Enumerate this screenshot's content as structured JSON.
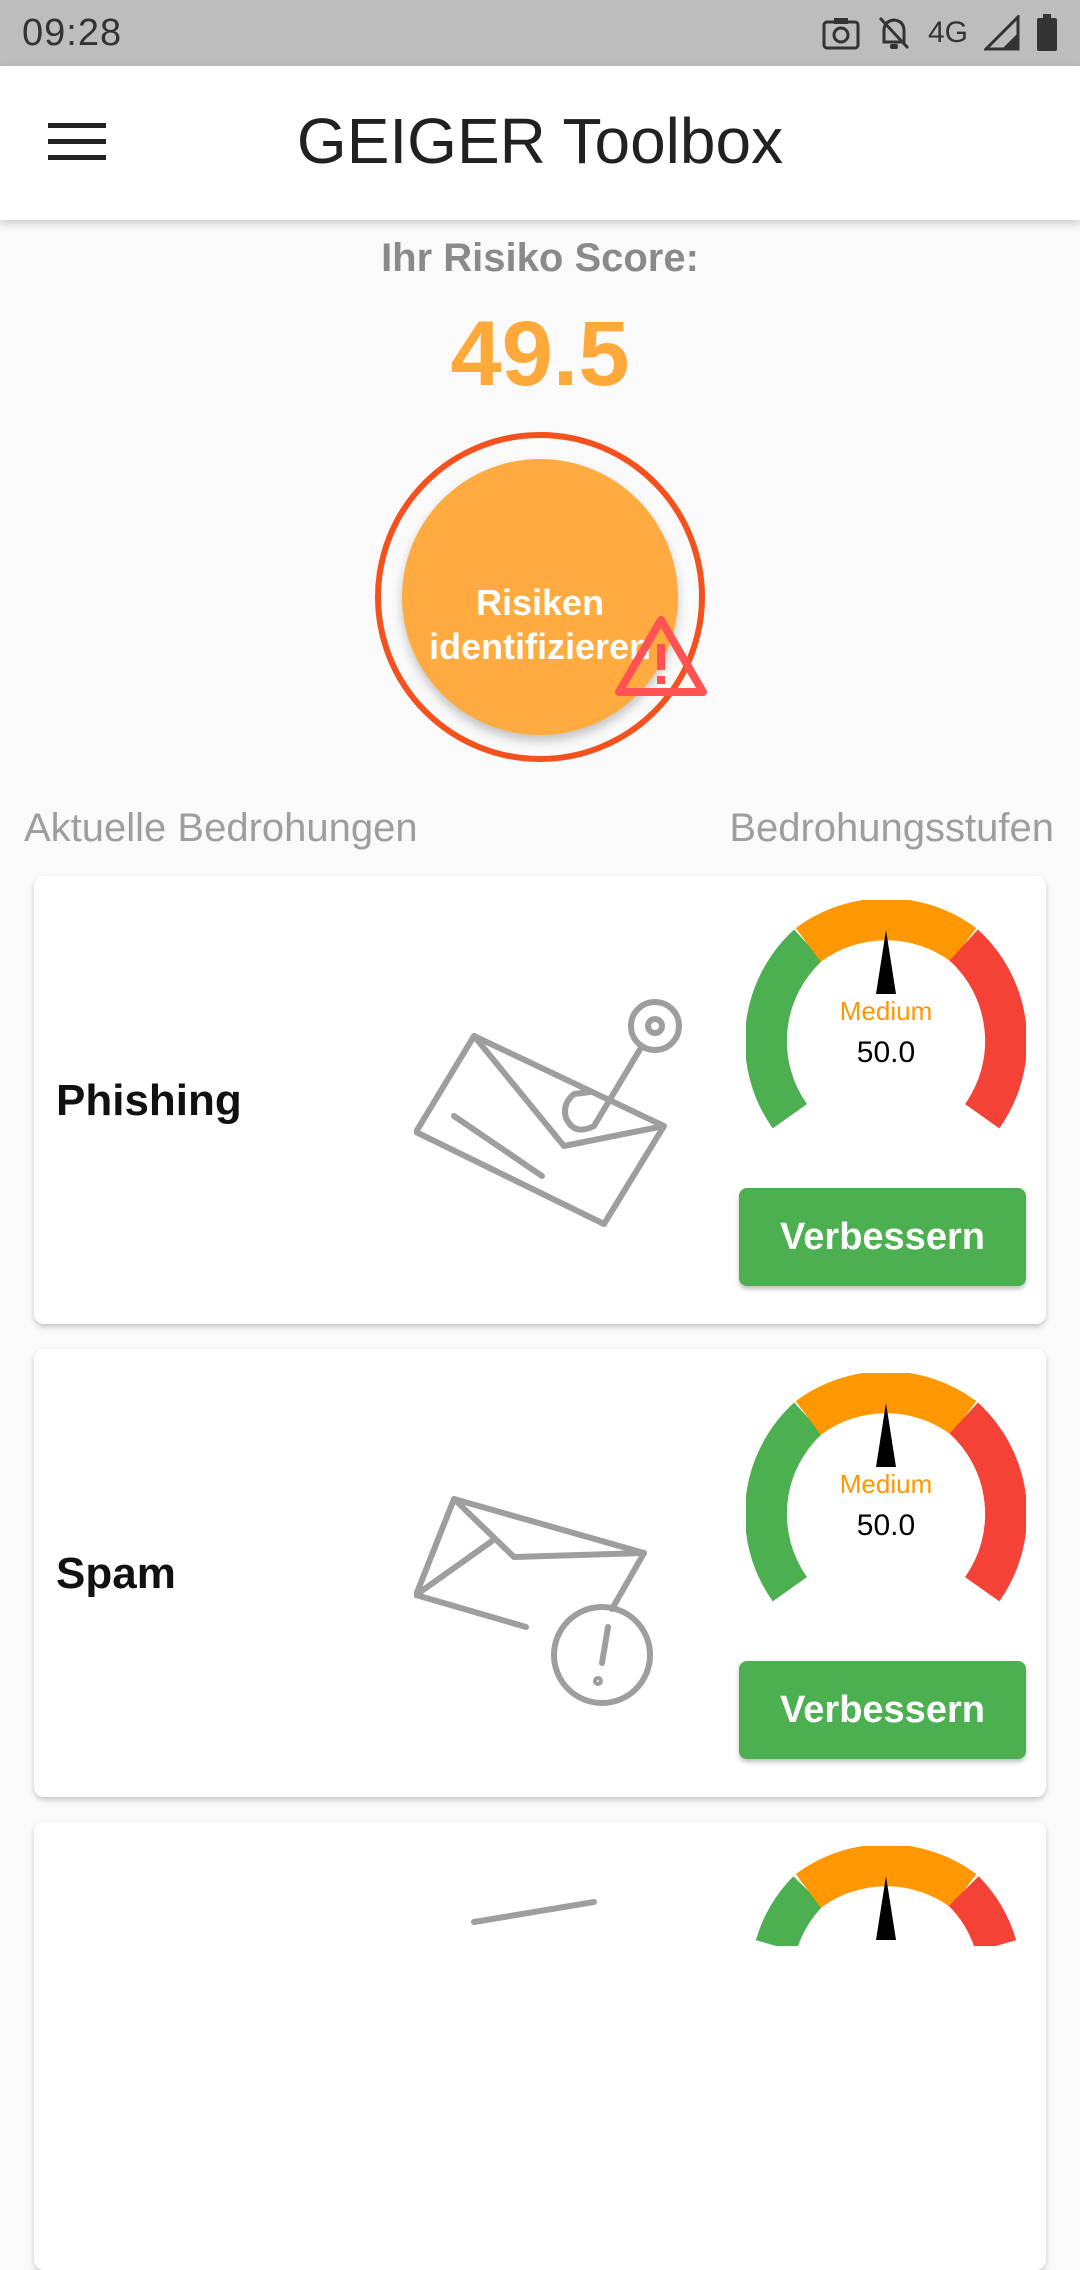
{
  "status_bar": {
    "time": "09:28",
    "network": "4G"
  },
  "app_bar": {
    "title": "GEIGER Toolbox",
    "menu_icon": "hamburger-menu-icon"
  },
  "score": {
    "label": "Ihr Risiko Score:",
    "value": "49.5",
    "color": "#ffa93a"
  },
  "risk_button": {
    "label_line1": "Risiken",
    "label_line2": "identifizieren",
    "icon": "warning-triangle-icon"
  },
  "sections": {
    "left": "Aktuelle Bedrohungen",
    "right": "Bedrohungsstufen"
  },
  "threats": [
    {
      "name": "Phishing",
      "icon": "phishing-envelope-hook-icon",
      "level_label": "Medium",
      "level_value": "50.0",
      "level": 0.5,
      "button": "Verbessern"
    },
    {
      "name": "Spam",
      "icon": "spam-envelope-alert-icon",
      "level_label": "Medium",
      "level_value": "50.0",
      "level": 0.5,
      "button": "Verbessern"
    }
  ],
  "colors": {
    "low": "#4caf50",
    "medium": "#ff9800",
    "high": "#f44336",
    "button": "#4caf50",
    "ring": "#f4511e"
  }
}
